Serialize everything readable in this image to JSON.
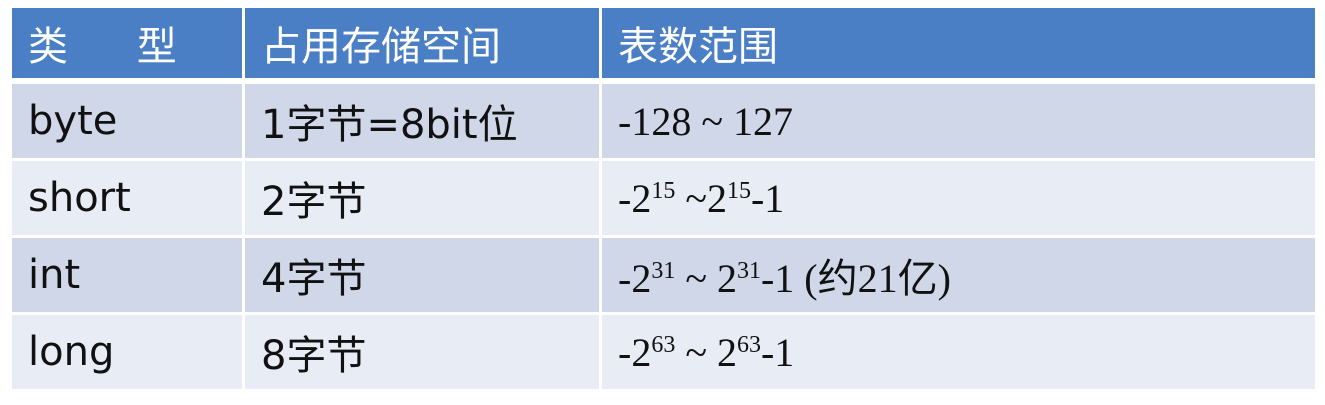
{
  "colors": {
    "header_bg": "#4a7fc5",
    "row_odd_bg": "#cfd7e8",
    "row_even_bg": "#e8ecf4",
    "highlight_text": "#d0311b"
  },
  "headers": {
    "type": "类 型",
    "storage": "占用存储空间",
    "range": "表数范围"
  },
  "rows": [
    {
      "type": "byte",
      "storage": "1字节=8bit位",
      "range": {
        "text": "-128 ~ 127"
      },
      "highlight": true
    },
    {
      "type": "short",
      "storage": "2字节",
      "range": {
        "minus": "-2",
        "exp1": "15",
        "mid": " ~2",
        "exp2": "15",
        "tail": "-1",
        "note": ""
      }
    },
    {
      "type": "int",
      "storage": "4字节",
      "range": {
        "minus": "-2",
        "exp1": "31",
        "mid": " ~ 2",
        "exp2": "31",
        "tail": "-1",
        "note": " (约21亿)"
      }
    },
    {
      "type": "long",
      "storage": "8字节",
      "range": {
        "minus": "-2",
        "exp1": "63",
        "mid": " ~ 2",
        "exp2": "63",
        "tail": "-1",
        "note": ""
      }
    }
  ]
}
